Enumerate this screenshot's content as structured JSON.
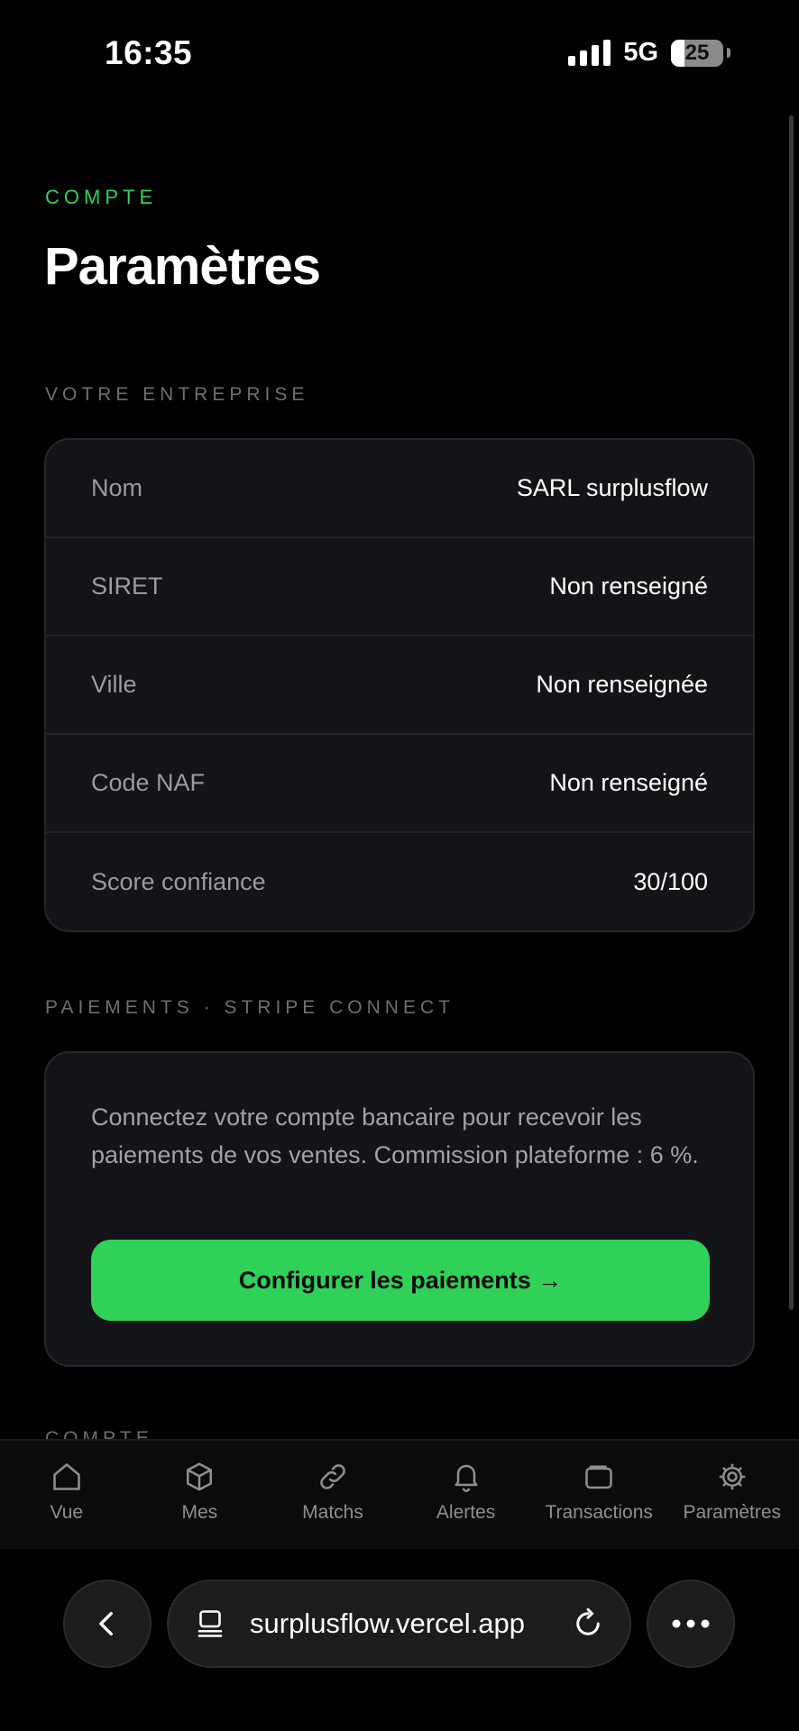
{
  "status_bar": {
    "time": "16:35",
    "network": "5G",
    "battery": "25"
  },
  "header": {
    "eyebrow": "COMPTE",
    "title": "Paramètres"
  },
  "company": {
    "section_label": "VOTRE ENTREPRISE",
    "rows": [
      {
        "label": "Nom",
        "value": "SARL surplusflow"
      },
      {
        "label": "SIRET",
        "value": "Non renseigné"
      },
      {
        "label": "Ville",
        "value": "Non renseignée"
      },
      {
        "label": "Code NAF",
        "value": "Non renseigné"
      },
      {
        "label": "Score confiance",
        "value": "30/100"
      }
    ]
  },
  "payments": {
    "section_label": "PAIEMENTS · STRIPE CONNECT",
    "description": "Connectez votre compte bancaire pour recevoir les paiements de vos ventes. Commission plateforme : 6 %.",
    "button_label": "Configurer les paiements →"
  },
  "next_section_label": "COMPTE",
  "tabs": [
    {
      "label": "Vue",
      "icon": "home-icon"
    },
    {
      "label": "Mes",
      "icon": "box-icon"
    },
    {
      "label": "Matchs",
      "icon": "link-icon"
    },
    {
      "label": "Alertes",
      "icon": "bell-icon"
    },
    {
      "label": "Transactions",
      "icon": "wallet-icon"
    },
    {
      "label": "Paramètres",
      "icon": "gear-icon"
    }
  ],
  "browser": {
    "url": "surplusflow.vercel.app"
  },
  "colors": {
    "accent": "#30d158",
    "background": "#000000",
    "card": "#131417"
  }
}
